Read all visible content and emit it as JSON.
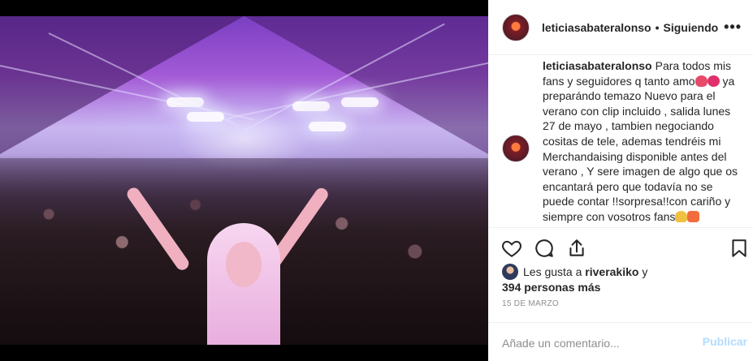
{
  "post": {
    "username": "leticiasabateralonso",
    "separator": "•",
    "follow_status": "Siguiendo",
    "more_icon": "more-dots-icon"
  },
  "caption": {
    "username": "leticiasabateralonso",
    "text_part1": "Para todos mis fans y seguidores q tanto amo",
    "text_part2": "ya preparándo temazo Nuevo para el verano con clip incluido , salida lunes 27 de mayo , tambien negociando cositas de tele, ademas tendréis mi Merchandaising disponible antes del verano , Y sere imagen de algo que os encantará pero que todavía no se puede contar !!sorpresa!!con cariño y siempre con vosotros fans"
  },
  "actions": {
    "icons": [
      "heart-icon",
      "comment-icon",
      "share-icon",
      "bookmark-icon"
    ]
  },
  "likes": {
    "prefix": "Les gusta a",
    "user": "riverakiko",
    "connector": "y",
    "count_text": "394 personas más"
  },
  "date": "15 DE MARZO",
  "comment": {
    "placeholder": "Añade un comentario...",
    "publish_label": "Publicar",
    "publish_color": "#b3dbff"
  }
}
